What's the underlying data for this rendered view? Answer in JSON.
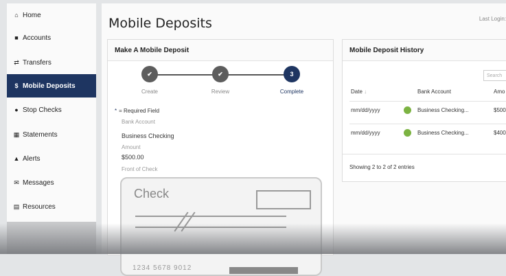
{
  "sidebar": {
    "items": [
      {
        "icon": "home-icon",
        "glyph": "⌂",
        "label": "Home",
        "active": false
      },
      {
        "icon": "accounts-icon",
        "glyph": "■",
        "label": "Accounts",
        "active": false
      },
      {
        "icon": "transfers-icon",
        "glyph": "⇄",
        "label": "Transfers",
        "active": false
      },
      {
        "icon": "dollar-icon",
        "glyph": "$",
        "label": "Mobile Deposits",
        "active": true
      },
      {
        "icon": "stop-icon",
        "glyph": "●",
        "label": "Stop Checks",
        "active": false
      },
      {
        "icon": "statements-icon",
        "glyph": "▦",
        "label": "Statements",
        "active": false
      },
      {
        "icon": "bell-icon",
        "glyph": "▲",
        "label": "Alerts",
        "active": false
      },
      {
        "icon": "envelope-icon",
        "glyph": "✉",
        "label": "Messages",
        "active": false
      },
      {
        "icon": "book-icon",
        "glyph": "▤",
        "label": "Resources",
        "active": false
      }
    ]
  },
  "header": {
    "title": "Mobile Deposits",
    "last_login": "Last Login:"
  },
  "deposit_panel": {
    "title": "Make A Mobile Deposit",
    "steps": [
      {
        "label": "Create",
        "state": "done",
        "mark": "✔"
      },
      {
        "label": "Review",
        "state": "done",
        "mark": "✔"
      },
      {
        "label": "Complete",
        "state": "current",
        "mark": "3"
      }
    ],
    "required_mark": "*",
    "required_text": "= Required Field",
    "bank_account_label": "Bank Account",
    "bank_account_value": "Business Checking",
    "amount_label": "Amount",
    "amount_value": "$500.00",
    "front_label": "Front of Check",
    "check_image": {
      "title": "Check",
      "numbers": "1234 5678 9012"
    }
  },
  "history_panel": {
    "title": "Mobile Deposit History",
    "search_placeholder": "Search",
    "columns": [
      "Date",
      "Bank Account",
      "Amo"
    ],
    "sort_indicator": "↓",
    "rows": [
      {
        "date": "mm/dd/yyyy",
        "account": "Business Checking...",
        "amount": "$500",
        "status_color": "#7cb342"
      },
      {
        "date": "mm/dd/yyyy",
        "account": "Business Checking...",
        "amount": "$400",
        "status_color": "#7cb342"
      }
    ],
    "footer": "Showing 2 to 2 of 2 entries"
  },
  "colors": {
    "accent": "#1e3561",
    "success": "#7cb342"
  }
}
